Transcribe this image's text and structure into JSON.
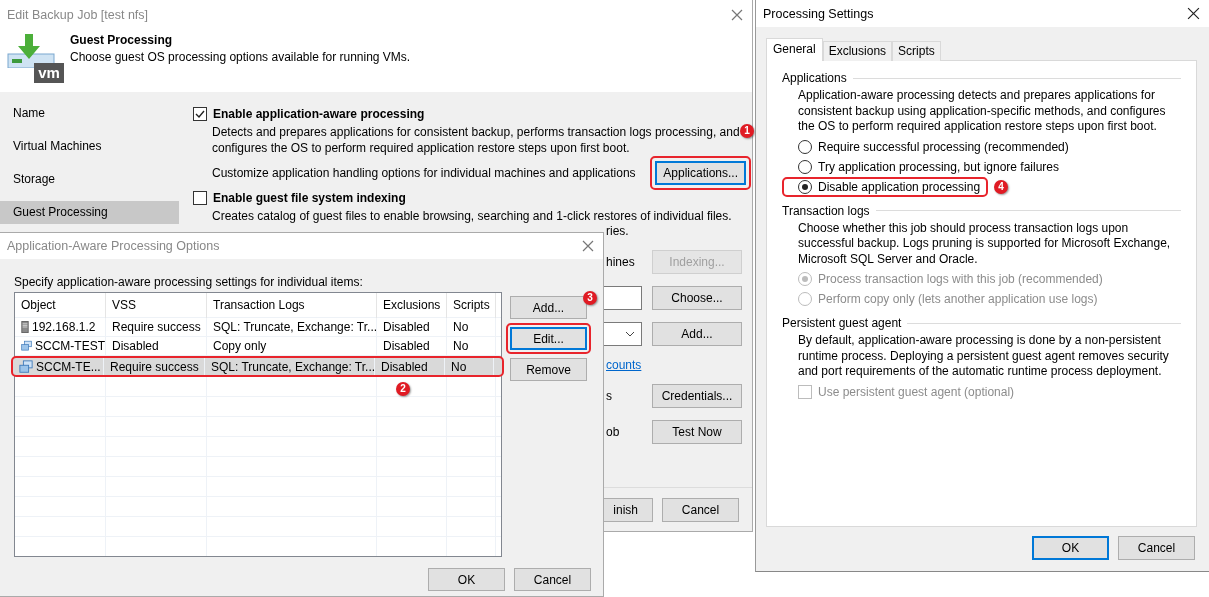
{
  "backup_job": {
    "title": "Edit Backup Job [test nfs]",
    "logo_text": "vm",
    "header_title": "Guest Processing",
    "header_subtitle": "Choose guest OS processing options available for running VMs.",
    "steps": [
      {
        "label": "Name",
        "selected": false
      },
      {
        "label": "Virtual Machines",
        "selected": false
      },
      {
        "label": "Storage",
        "selected": false
      },
      {
        "label": "Guest Processing",
        "selected": true
      }
    ],
    "app_aware": {
      "label": "Enable application-aware processing",
      "checked": true,
      "description": "Detects and prepares applications for consistent backup, performs transaction logs processing, and configures the OS to perform required application restore steps upon first boot.",
      "customize_text": "Customize application handling options for individual machines and applications",
      "button": {
        "label": "Applications...",
        "highlighted": true,
        "callout": "1"
      }
    },
    "indexing": {
      "label": "Enable guest file system indexing",
      "checked": false,
      "description": "Creates catalog of guest files to enable browsing, searching and 1-click restores of individual files."
    },
    "partial_rows": [
      {
        "kind": "text",
        "text": "ries."
      },
      {
        "kind": "button_row",
        "text": "hines",
        "button": "Indexing...",
        "disabled": true
      },
      {
        "kind": "field_row",
        "button": "Choose..."
      },
      {
        "kind": "dropdown_row",
        "button": "Add..."
      },
      {
        "kind": "link",
        "text": "counts"
      },
      {
        "kind": "button_row",
        "text": "s",
        "button": "Credentials...",
        "disabled": false
      },
      {
        "kind": "button_row",
        "text": "ob",
        "button": "Test Now",
        "disabled": false
      }
    ],
    "footer_buttons": [
      "inish",
      "Cancel"
    ]
  },
  "app_options": {
    "title": "Application-Aware Processing Options",
    "instruction": "Specify application-aware processing settings for individual items:",
    "columns": [
      "Object",
      "VSS",
      "Transaction Logs",
      "Exclusions",
      "Scripts"
    ],
    "rows": [
      {
        "kind": "host",
        "cells": [
          "192.168.1.2",
          "Require success",
          "SQL: Truncate, Exchange: Tr...",
          "Disabled",
          "No"
        ],
        "selected": false,
        "highlighted": false
      },
      {
        "kind": "vm",
        "cells": [
          "SCCM-TEST",
          "Disabled",
          "Copy only",
          "Disabled",
          "No"
        ],
        "selected": false,
        "highlighted": false
      },
      {
        "kind": "vm",
        "cells": [
          "SCCM-TE...",
          "Require success",
          "SQL: Truncate, Exchange: Tr...",
          "Disabled",
          "No"
        ],
        "selected": true,
        "highlighted": true,
        "callout": "2"
      }
    ],
    "side_buttons": [
      {
        "label": "Add...",
        "focused": false,
        "highlighted": false,
        "callout": "3"
      },
      {
        "label": "Edit...",
        "focused": true,
        "highlighted": true
      },
      {
        "label": "Remove",
        "focused": false,
        "highlighted": false
      }
    ],
    "footer_buttons": [
      "OK",
      "Cancel"
    ]
  },
  "processing_settings": {
    "title": "Processing Settings",
    "tabs": [
      {
        "label": "General",
        "selected": true
      },
      {
        "label": "Exclusions",
        "selected": false
      },
      {
        "label": "Scripts",
        "selected": false
      }
    ],
    "sections": [
      {
        "heading": "Applications",
        "description": "Application-aware processing detects and prepares applications for consistent backup using application-specific methods, and configures the OS to perform required application restore steps upon first boot.",
        "options": [
          {
            "kind": "radio",
            "label": "Require successful processing  (recommended)",
            "selected": false,
            "disabled": false,
            "highlighted": false
          },
          {
            "kind": "radio",
            "label": "Try application processing, but ignore failures",
            "selected": false,
            "disabled": false,
            "highlighted": false
          },
          {
            "kind": "radio",
            "label": "Disable application processing",
            "selected": true,
            "disabled": false,
            "highlighted": true,
            "callout": "4"
          }
        ]
      },
      {
        "heading": "Transaction logs",
        "description": "Choose whether this job should process transaction logs upon successful backup. Logs pruning is supported for Microsoft Exchange, Microsoft SQL Server and Oracle.",
        "options": [
          {
            "kind": "radio",
            "label": "Process transaction logs with this job (recommended)",
            "selected": true,
            "disabled": true,
            "highlighted": false
          },
          {
            "kind": "radio",
            "label": "Perform copy only (lets another application use logs)",
            "selected": false,
            "disabled": true,
            "highlighted": false
          }
        ]
      },
      {
        "heading": "Persistent guest agent",
        "description": "By default, application-aware processing is done by a non-persistent runtime process. Deploying a persistent guest agent removes security and port requirements of the automatic runtime process deployment.",
        "options": [
          {
            "kind": "checkbox",
            "label": "Use persistent guest agent (optional)",
            "checked": false,
            "disabled": true,
            "highlighted": false
          }
        ]
      }
    ],
    "buttons": [
      {
        "label": "OK",
        "focused": true
      },
      {
        "label": "Cancel",
        "focused": false
      }
    ]
  }
}
